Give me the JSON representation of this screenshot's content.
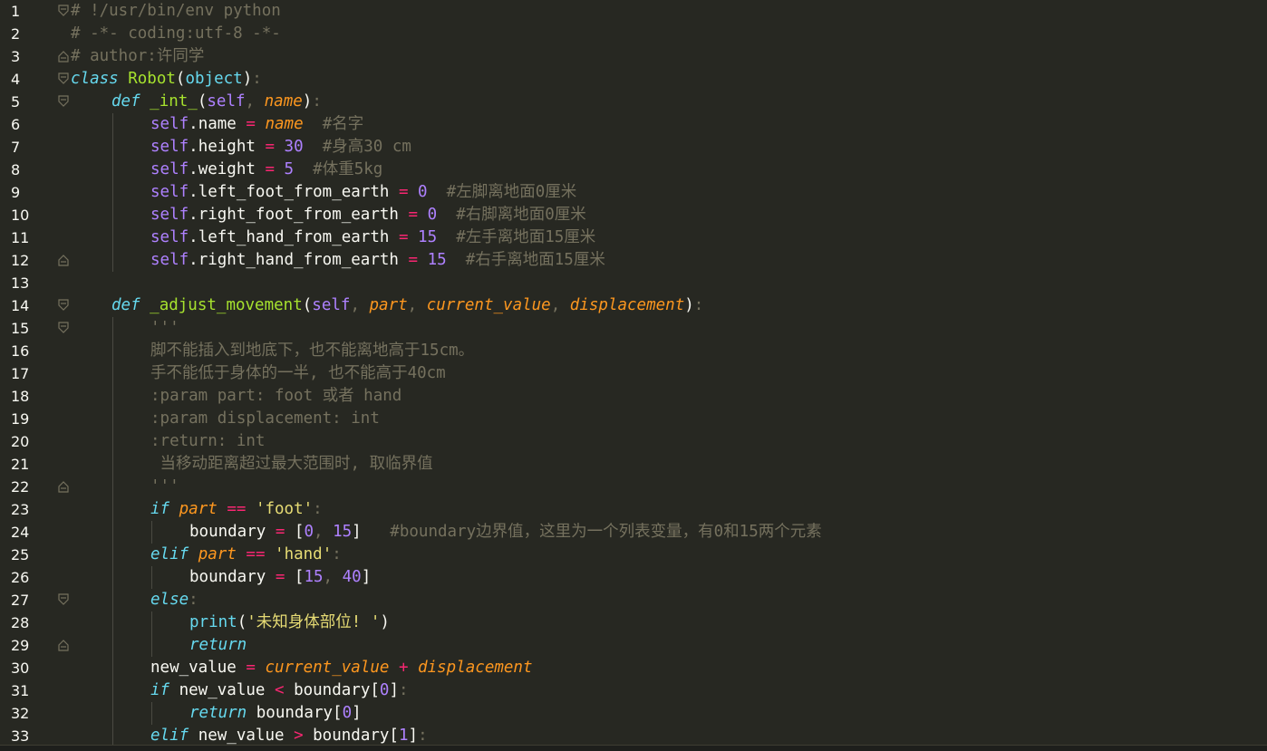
{
  "editor": {
    "lines": [
      {
        "num": "1",
        "fold": "open",
        "indent": 0,
        "tokens": [
          {
            "t": "# !/usr/bin/env python",
            "c": "comment"
          }
        ]
      },
      {
        "num": "2",
        "fold": "",
        "indent": 0,
        "tokens": [
          {
            "t": "# -*- coding:utf-8 -*-",
            "c": "comment"
          }
        ]
      },
      {
        "num": "3",
        "fold": "end",
        "indent": 0,
        "tokens": [
          {
            "t": "# author:许同学",
            "c": "comment"
          }
        ]
      },
      {
        "num": "4",
        "fold": "open",
        "indent": 0,
        "tokens": [
          {
            "t": "class",
            "c": "kw"
          },
          {
            "t": " ",
            "c": "plain"
          },
          {
            "t": "Robot",
            "c": "class"
          },
          {
            "t": "(",
            "c": "punc"
          },
          {
            "t": "object",
            "c": "builtin"
          },
          {
            "t": ")",
            "c": "punc"
          },
          {
            "t": ":",
            "c": "dim"
          }
        ]
      },
      {
        "num": "5",
        "fold": "open",
        "indent": 1,
        "tokens": [
          {
            "t": "def",
            "c": "kw"
          },
          {
            "t": " ",
            "c": "plain"
          },
          {
            "t": "_int_",
            "c": "fn"
          },
          {
            "t": "(",
            "c": "punc"
          },
          {
            "t": "self",
            "c": "self"
          },
          {
            "t": ", ",
            "c": "dim"
          },
          {
            "t": "name",
            "c": "param"
          },
          {
            "t": ")",
            "c": "punc"
          },
          {
            "t": ":",
            "c": "dim"
          }
        ]
      },
      {
        "num": "6",
        "fold": "",
        "indent": 2,
        "tokens": [
          {
            "t": "self",
            "c": "self"
          },
          {
            "t": ".name ",
            "c": "plain"
          },
          {
            "t": "=",
            "c": "op"
          },
          {
            "t": " ",
            "c": "plain"
          },
          {
            "t": "name",
            "c": "param"
          },
          {
            "t": "  #名字",
            "c": "comment"
          }
        ]
      },
      {
        "num": "7",
        "fold": "",
        "indent": 2,
        "tokens": [
          {
            "t": "self",
            "c": "self"
          },
          {
            "t": ".height ",
            "c": "plain"
          },
          {
            "t": "=",
            "c": "op"
          },
          {
            "t": " ",
            "c": "plain"
          },
          {
            "t": "30",
            "c": "num"
          },
          {
            "t": "  #身高30 cm",
            "c": "comment"
          }
        ]
      },
      {
        "num": "8",
        "fold": "",
        "indent": 2,
        "tokens": [
          {
            "t": "self",
            "c": "self"
          },
          {
            "t": ".weight ",
            "c": "plain"
          },
          {
            "t": "=",
            "c": "op"
          },
          {
            "t": " ",
            "c": "plain"
          },
          {
            "t": "5",
            "c": "num"
          },
          {
            "t": "  #体重5kg",
            "c": "comment"
          }
        ]
      },
      {
        "num": "9",
        "fold": "",
        "indent": 2,
        "tokens": [
          {
            "t": "self",
            "c": "self"
          },
          {
            "t": ".left_foot_from_earth ",
            "c": "plain"
          },
          {
            "t": "=",
            "c": "op"
          },
          {
            "t": " ",
            "c": "plain"
          },
          {
            "t": "0",
            "c": "num"
          },
          {
            "t": "  #左脚离地面0厘米",
            "c": "comment"
          }
        ]
      },
      {
        "num": "10",
        "fold": "",
        "indent": 2,
        "tokens": [
          {
            "t": "self",
            "c": "self"
          },
          {
            "t": ".right_foot_from_earth ",
            "c": "plain"
          },
          {
            "t": "=",
            "c": "op"
          },
          {
            "t": " ",
            "c": "plain"
          },
          {
            "t": "0",
            "c": "num"
          },
          {
            "t": "  #右脚离地面0厘米",
            "c": "comment"
          }
        ]
      },
      {
        "num": "11",
        "fold": "",
        "indent": 2,
        "tokens": [
          {
            "t": "self",
            "c": "self"
          },
          {
            "t": ".left_hand_from_earth ",
            "c": "plain"
          },
          {
            "t": "=",
            "c": "op"
          },
          {
            "t": " ",
            "c": "plain"
          },
          {
            "t": "15",
            "c": "num"
          },
          {
            "t": "  #左手离地面15厘米",
            "c": "comment"
          }
        ]
      },
      {
        "num": "12",
        "fold": "end",
        "indent": 2,
        "tokens": [
          {
            "t": "self",
            "c": "self"
          },
          {
            "t": ".right_hand_from_earth ",
            "c": "plain"
          },
          {
            "t": "=",
            "c": "op"
          },
          {
            "t": " ",
            "c": "plain"
          },
          {
            "t": "15",
            "c": "num"
          },
          {
            "t": "  #右手离地面15厘米",
            "c": "comment"
          }
        ]
      },
      {
        "num": "13",
        "fold": "",
        "indent": 0,
        "tokens": []
      },
      {
        "num": "14",
        "fold": "open",
        "indent": 1,
        "tokens": [
          {
            "t": "def",
            "c": "kw"
          },
          {
            "t": " ",
            "c": "plain"
          },
          {
            "t": "_adjust_movement",
            "c": "fn"
          },
          {
            "t": "(",
            "c": "punc"
          },
          {
            "t": "self",
            "c": "self"
          },
          {
            "t": ", ",
            "c": "dim"
          },
          {
            "t": "part",
            "c": "param"
          },
          {
            "t": ", ",
            "c": "dim"
          },
          {
            "t": "current_value",
            "c": "param"
          },
          {
            "t": ", ",
            "c": "dim"
          },
          {
            "t": "displacement",
            "c": "param"
          },
          {
            "t": ")",
            "c": "punc"
          },
          {
            "t": ":",
            "c": "dim"
          }
        ]
      },
      {
        "num": "15",
        "fold": "open",
        "indent": 2,
        "tokens": [
          {
            "t": "'''",
            "c": "doc"
          }
        ]
      },
      {
        "num": "16",
        "fold": "",
        "indent": 2,
        "tokens": [
          {
            "t": "脚不能插入到地底下，也不能离地高于15cm。",
            "c": "doc"
          }
        ]
      },
      {
        "num": "17",
        "fold": "",
        "indent": 2,
        "tokens": [
          {
            "t": "手不能低于身体的一半, 也不能高于40cm",
            "c": "doc"
          }
        ]
      },
      {
        "num": "18",
        "fold": "",
        "indent": 2,
        "tokens": [
          {
            "t": ":param part: foot 或者 hand",
            "c": "doc"
          }
        ]
      },
      {
        "num": "19",
        "fold": "",
        "indent": 2,
        "tokens": [
          {
            "t": ":param displacement: int",
            "c": "doc"
          }
        ]
      },
      {
        "num": "20",
        "fold": "",
        "indent": 2,
        "tokens": [
          {
            "t": ":return: int",
            "c": "doc"
          }
        ]
      },
      {
        "num": "21",
        "fold": "",
        "indent": 2,
        "tokens": [
          {
            "t": " 当移动距离超过最大范围时, 取临界值",
            "c": "doc"
          }
        ]
      },
      {
        "num": "22",
        "fold": "end",
        "indent": 2,
        "tokens": [
          {
            "t": "'''",
            "c": "doc"
          }
        ]
      },
      {
        "num": "23",
        "fold": "",
        "indent": 2,
        "tokens": [
          {
            "t": "if",
            "c": "kw"
          },
          {
            "t": " ",
            "c": "plain"
          },
          {
            "t": "part",
            "c": "param"
          },
          {
            "t": " ",
            "c": "plain"
          },
          {
            "t": "==",
            "c": "op"
          },
          {
            "t": " ",
            "c": "plain"
          },
          {
            "t": "'foot'",
            "c": "str"
          },
          {
            "t": ":",
            "c": "dim"
          }
        ]
      },
      {
        "num": "24",
        "fold": "",
        "indent": 3,
        "tokens": [
          {
            "t": "boundary ",
            "c": "plain"
          },
          {
            "t": "=",
            "c": "op"
          },
          {
            "t": " [",
            "c": "plain"
          },
          {
            "t": "0",
            "c": "num"
          },
          {
            "t": ", ",
            "c": "dim"
          },
          {
            "t": "15",
            "c": "num"
          },
          {
            "t": "]",
            "c": "plain"
          },
          {
            "t": "   #boundary边界值，这里为一个列表变量，有0和15两个元素",
            "c": "comment"
          }
        ]
      },
      {
        "num": "25",
        "fold": "",
        "indent": 2,
        "tokens": [
          {
            "t": "elif",
            "c": "kw"
          },
          {
            "t": " ",
            "c": "plain"
          },
          {
            "t": "part",
            "c": "param"
          },
          {
            "t": " ",
            "c": "plain"
          },
          {
            "t": "==",
            "c": "op"
          },
          {
            "t": " ",
            "c": "plain"
          },
          {
            "t": "'hand'",
            "c": "str"
          },
          {
            "t": ":",
            "c": "dim"
          }
        ]
      },
      {
        "num": "26",
        "fold": "",
        "indent": 3,
        "tokens": [
          {
            "t": "boundary ",
            "c": "plain"
          },
          {
            "t": "=",
            "c": "op"
          },
          {
            "t": " [",
            "c": "plain"
          },
          {
            "t": "15",
            "c": "num"
          },
          {
            "t": ", ",
            "c": "dim"
          },
          {
            "t": "40",
            "c": "num"
          },
          {
            "t": "]",
            "c": "plain"
          }
        ]
      },
      {
        "num": "27",
        "fold": "open",
        "indent": 2,
        "tokens": [
          {
            "t": "else",
            "c": "kw"
          },
          {
            "t": ":",
            "c": "dim"
          }
        ]
      },
      {
        "num": "28",
        "fold": "",
        "indent": 3,
        "tokens": [
          {
            "t": "print",
            "c": "func"
          },
          {
            "t": "(",
            "c": "punc"
          },
          {
            "t": "'未知身体部位! '",
            "c": "str"
          },
          {
            "t": ")",
            "c": "punc"
          }
        ]
      },
      {
        "num": "29",
        "fold": "end",
        "indent": 3,
        "tokens": [
          {
            "t": "return",
            "c": "kw"
          }
        ]
      },
      {
        "num": "30",
        "fold": "",
        "indent": 2,
        "tokens": [
          {
            "t": "new_value ",
            "c": "plain"
          },
          {
            "t": "=",
            "c": "op"
          },
          {
            "t": " ",
            "c": "plain"
          },
          {
            "t": "current_value",
            "c": "param"
          },
          {
            "t": " ",
            "c": "plain"
          },
          {
            "t": "+",
            "c": "op"
          },
          {
            "t": " ",
            "c": "plain"
          },
          {
            "t": "displacement",
            "c": "param"
          }
        ]
      },
      {
        "num": "31",
        "fold": "",
        "indent": 2,
        "tokens": [
          {
            "t": "if",
            "c": "kw"
          },
          {
            "t": " new_value ",
            "c": "plain"
          },
          {
            "t": "<",
            "c": "op"
          },
          {
            "t": " boundary[",
            "c": "plain"
          },
          {
            "t": "0",
            "c": "num"
          },
          {
            "t": "]",
            "c": "plain"
          },
          {
            "t": ":",
            "c": "dim"
          }
        ]
      },
      {
        "num": "32",
        "fold": "",
        "indent": 3,
        "tokens": [
          {
            "t": "return",
            "c": "kw"
          },
          {
            "t": " boundary[",
            "c": "plain"
          },
          {
            "t": "0",
            "c": "num"
          },
          {
            "t": "]",
            "c": "plain"
          }
        ]
      },
      {
        "num": "33",
        "fold": "",
        "indent": 2,
        "tokens": [
          {
            "t": "elif",
            "c": "kw"
          },
          {
            "t": " new_value ",
            "c": "plain"
          },
          {
            "t": ">",
            "c": "op"
          },
          {
            "t": " boundary[",
            "c": "plain"
          },
          {
            "t": "1",
            "c": "num"
          },
          {
            "t": "]",
            "c": "plain"
          },
          {
            "t": ":",
            "c": "dim"
          }
        ]
      }
    ]
  },
  "theme": {
    "background": "#272822",
    "keyword": "#66d9ef",
    "class_name": "#a6e22e",
    "self": "#ae81ff",
    "param": "#fd971f",
    "operator": "#f92672",
    "number": "#ae81ff",
    "string": "#e6db74",
    "comment": "#75715e",
    "text": "#f8f8f2"
  }
}
